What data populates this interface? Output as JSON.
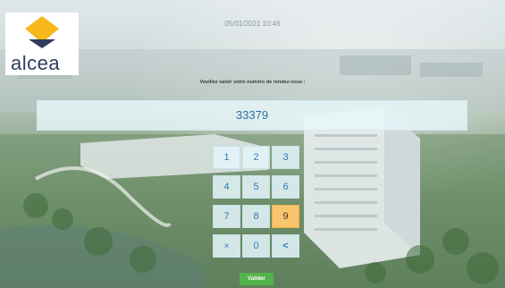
{
  "header": {
    "datetime": "05/01/2021 10:46",
    "brand": "alcea",
    "brand_colors": {
      "yellow": "#f6b81a",
      "navy": "#2f3d5a"
    }
  },
  "form": {
    "prompt": "Veuillez saisir votre numéro de rendez-vous :",
    "value": "33379"
  },
  "keypad": {
    "keys": [
      "1",
      "2",
      "3",
      "4",
      "5",
      "6",
      "7",
      "8",
      "9",
      "×",
      "0",
      "<"
    ],
    "active_key": "9",
    "active_color": "#f8c46d"
  },
  "actions": {
    "submit_label": "Valider",
    "submit_color": "#55b34c"
  }
}
